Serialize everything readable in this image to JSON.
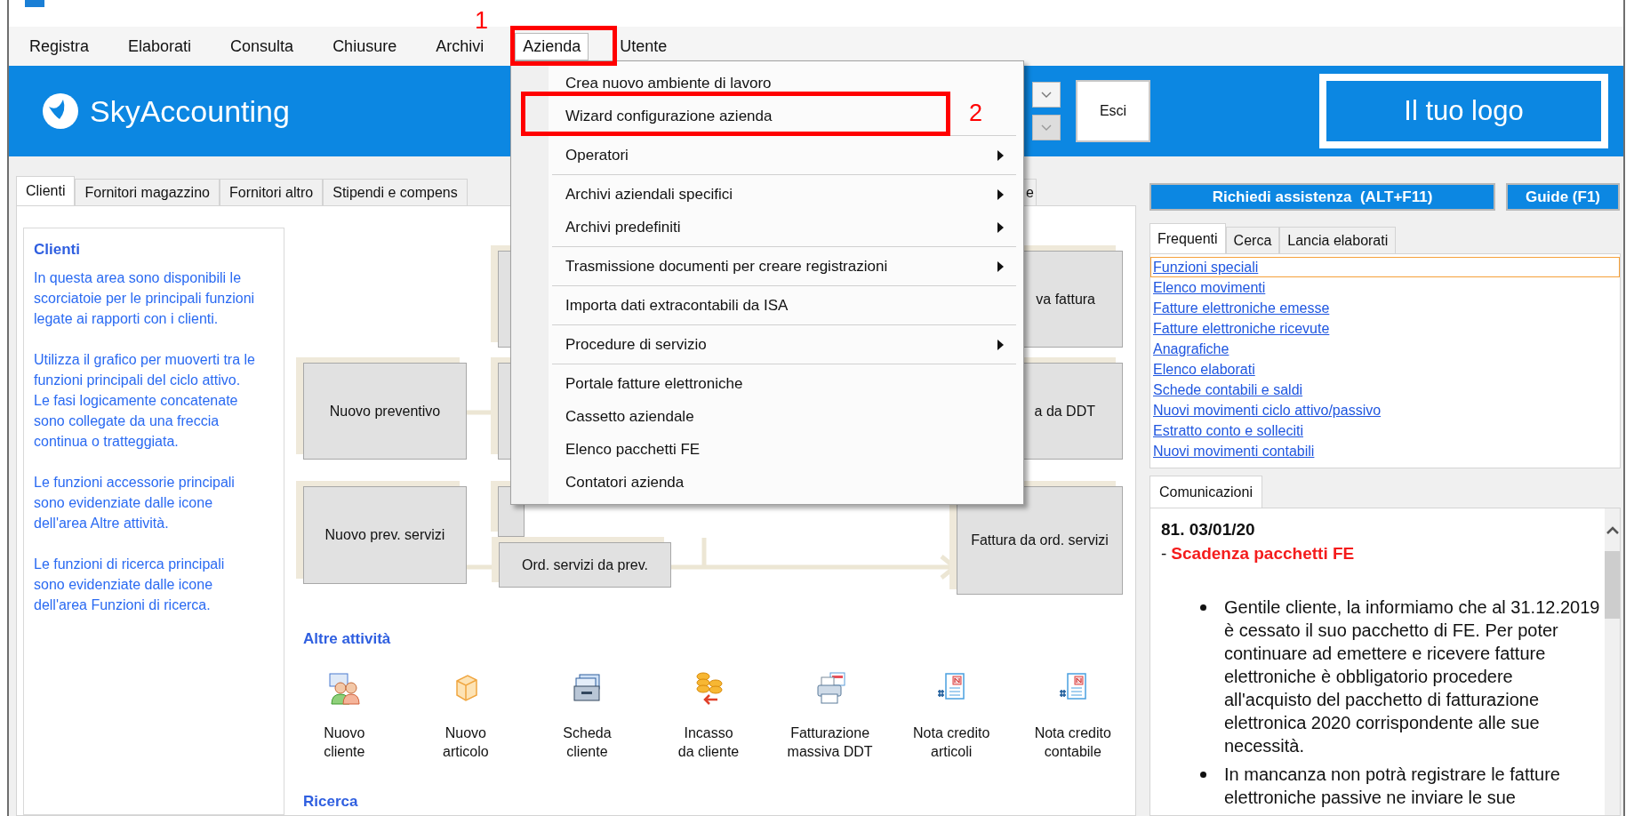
{
  "menu_bar": [
    {
      "label": "Registra",
      "selected": false
    },
    {
      "label": "Elaborati",
      "selected": false
    },
    {
      "label": "Consulta",
      "selected": false
    },
    {
      "label": "Chiusure",
      "selected": false
    },
    {
      "label": "Archivi",
      "selected": false
    },
    {
      "label": "Azienda",
      "selected": true
    },
    {
      "label": "Utente",
      "selected": false
    }
  ],
  "annotations": [
    "1",
    "2"
  ],
  "header": {
    "logo": "SkyAccounting",
    "exit_button": "Esci",
    "logo_placeholder": "Il tuo logo"
  },
  "dropdown_menu": [
    [
      {
        "label": "Crea nuovo ambiente di lavoro",
        "submenu": false
      },
      {
        "label": "Wizard configurazione azienda",
        "submenu": false
      }
    ],
    [
      {
        "label": "Operatori",
        "submenu": true
      }
    ],
    [
      {
        "label": "Archivi aziendali specifici",
        "submenu": true
      },
      {
        "label": "Archivi predefiniti",
        "submenu": true
      }
    ],
    [
      {
        "label": "Trasmissione documenti per creare registrazioni",
        "submenu": true
      }
    ],
    [
      {
        "label": "Importa dati extracontabili da ISA",
        "submenu": false
      }
    ],
    [
      {
        "label": "Procedure di servizio",
        "submenu": true
      }
    ],
    [
      {
        "label": "Portale fatture elettroniche",
        "submenu": false
      },
      {
        "label": "Cassetto aziendale",
        "submenu": false
      },
      {
        "label": "Elenco pacchetti FE",
        "submenu": false
      },
      {
        "label": "Contatori azienda",
        "submenu": false
      }
    ]
  ],
  "tabs": [
    {
      "label": "Clienti",
      "selected": true
    },
    {
      "label": "Fornitori magazzino",
      "selected": false
    },
    {
      "label": "Fornitori altro",
      "selected": false
    },
    {
      "label": "Stipendi e compens",
      "selected": false
    },
    {
      "label": "e",
      "selected": false
    }
  ],
  "description": {
    "title": "Clienti",
    "paragraphs": [
      "In questa area sono disponibili le scorciatoie per le principali funzioni legate ai rapporti con i clienti.",
      "Utilizza il grafico per muoverti tra le funzioni principali del ciclo attivo. Le fasi logicamente concatenate sono collegate da una freccia continua o tratteggiata.",
      "Le funzioni accessorie principali sono evidenziate dalle icone dell'area Altre attività.",
      "Le funzioni di ricerca principali sono evidenziate dalle icone dell'area Funzioni di ricerca."
    ]
  },
  "flowchart": {
    "nodes": [
      "Nuovo preventivo",
      "Nuovo prev. servizi",
      "Ord. servizi da prev.",
      "va fattura",
      "a da DDT",
      "Fattura da ord. servizi"
    ]
  },
  "other_activities": {
    "title": "Altre attività",
    "items": [
      [
        "Nuovo",
        "cliente"
      ],
      [
        "Nuovo",
        "articolo"
      ],
      [
        "Scheda",
        "cliente"
      ],
      [
        "Incasso",
        "da cliente"
      ],
      [
        "Fatturazione",
        "massiva DDT"
      ],
      [
        "Nota credito",
        "articoli"
      ],
      [
        "Nota credito",
        "contabile"
      ]
    ]
  },
  "search_section": {
    "title": "Ricerca"
  },
  "right_panel": {
    "assist_button": "Richiedi assistenza  (ALT+F11)",
    "guide_button": "Guide (F1)",
    "tabs": [
      {
        "label": "Frequenti",
        "selected": true
      },
      {
        "label": "Cerca",
        "selected": false
      },
      {
        "label": "Lancia elaborati",
        "selected": false
      }
    ],
    "links": [
      {
        "label": "Funzioni speciali",
        "focused": true
      },
      {
        "label": "Elenco movimenti",
        "focused": false
      },
      {
        "label": "Fatture elettroniche emesse",
        "focused": false
      },
      {
        "label": "Fatture elettroniche ricevute",
        "focused": false
      },
      {
        "label": "Anagrafiche",
        "focused": false
      },
      {
        "label": "Elenco elaborati",
        "focused": false
      },
      {
        "label": "Schede contabili e saldi",
        "focused": false
      },
      {
        "label": "Nuovi movimenti ciclo attivo/passivo",
        "focused": false
      },
      {
        "label": "Estratto conto e solleciti",
        "focused": false
      },
      {
        "label": "Nuovi movimenti contabili",
        "focused": false
      }
    ]
  },
  "communications": {
    "tab": "Comunicazioni",
    "number": "81. 03/01/20",
    "prefix": "-",
    "title": "Scadenza pacchetti FE",
    "bullets": [
      "Gentile cliente, la informiamo che al 31.12.2019 è cessato il suo pacchetto di FE. Per poter continuare ad emettere e ricevere fatture elettroniche è obbligatorio procedere all'acquisto del pacchetto di fatturazione elettronica 2020 corrispondente alle sue necessità.",
      "In mancanza non potrà registrare le fatture elettroniche passive ne inviare le sue"
    ]
  }
}
